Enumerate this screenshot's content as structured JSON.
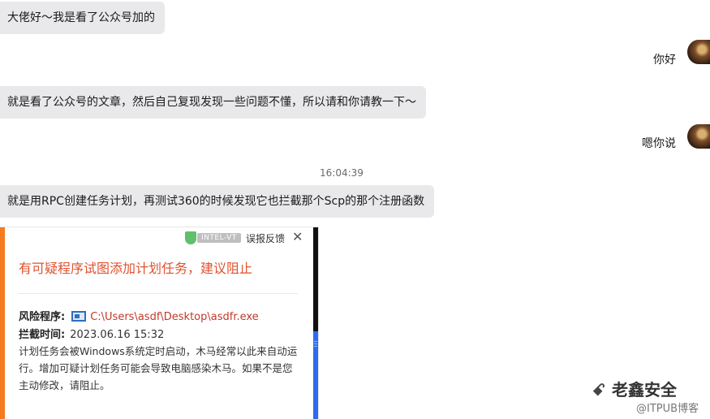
{
  "messages": [
    {
      "side": "left",
      "text": "大佬好～我是看了公众号加的"
    },
    {
      "side": "right",
      "text": "你好"
    },
    {
      "side": "left",
      "text": "就是看了公众号的文章，然后自己复现发现一些问题不懂，所以请和你请教一下～"
    },
    {
      "side": "right",
      "text": "嗯你说"
    },
    {
      "side": "left",
      "text": "就是用RPC创建任务计划，再测试360的时候发现它也拦截那个Scp的那个注册函数"
    }
  ],
  "timestamp": "16:04:39",
  "popup": {
    "tag": "INTEL-VT",
    "feedback": "误报反馈",
    "close": "✕",
    "title": "有可疑程序试图添加计划任务，建议阻止",
    "program_label": "风险程序:",
    "program_path": "C:\\Users\\asdf\\Desktop\\asdfr.exe",
    "time_label": "拦截时间:",
    "time_value": "2023.06.16 15:32",
    "description": "计划任务会被Windows系统定时启动，木马经常以此来自动运行。增加可疑计划任务可能会导致电脑感染木马。如果不是您主动修改，请阻止。",
    "accent_color": "#f47b20"
  },
  "watermark": {
    "name": "老鑫安全",
    "sub": "@ITPUB博客"
  }
}
